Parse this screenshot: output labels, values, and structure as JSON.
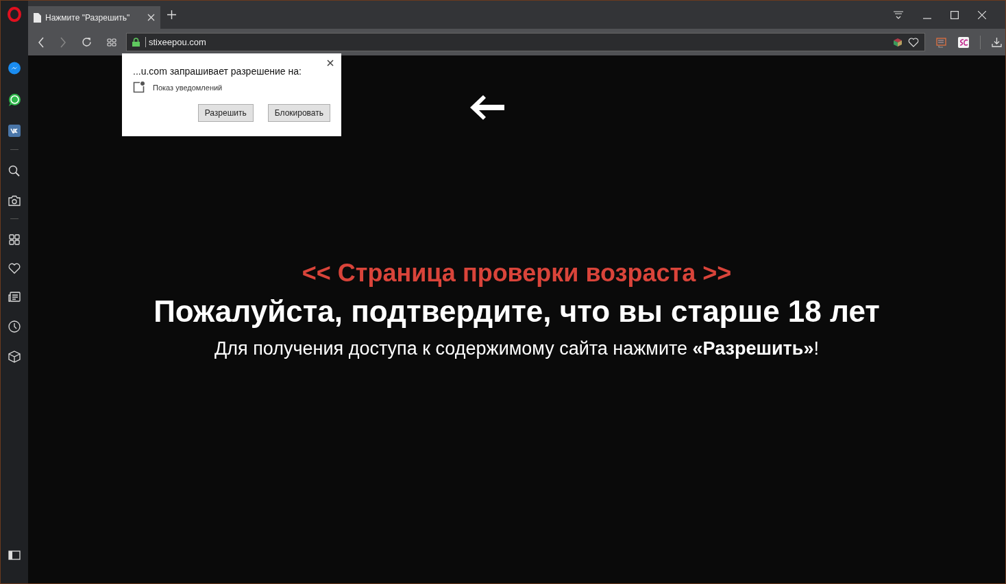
{
  "tab": {
    "title": "Нажмите \"Разрешить\""
  },
  "address_bar": {
    "url": "stixeepou.com"
  },
  "permission_popup": {
    "title": "...u.com запрашивает разрешение на:",
    "permission": "Показ уведомлений",
    "buttons": [
      "Разрешить",
      "Блокировать"
    ]
  },
  "page": {
    "overline": "<< Страница проверки возраста >>",
    "heading": "Пожалуйста, подтвердите, что вы старше 18 лет",
    "subtitle": "Для получения доступа к содержимому сайта нажмите **«Разрешить»**!"
  }
}
